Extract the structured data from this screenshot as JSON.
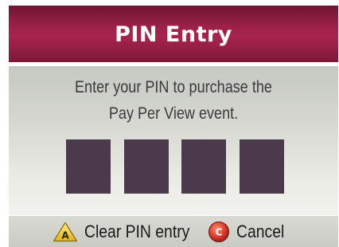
{
  "dialog": {
    "title": "PIN Entry",
    "prompt_line1": "Enter your PIN to purchase the",
    "prompt_line2": "Pay Per View event.",
    "pin_digits": [
      "",
      "",
      "",
      ""
    ]
  },
  "footer": {
    "clear": {
      "key": "A",
      "label": "Clear PIN entry",
      "icon": "a-button-icon",
      "color": "#f2d23a"
    },
    "cancel": {
      "key": "C",
      "label": "Cancel",
      "icon": "c-button-icon",
      "color": "#d83a2a"
    }
  },
  "colors": {
    "title_bar": "#9a2048",
    "pin_box": "#4b3a4b",
    "panel": "#d4d6cf"
  }
}
